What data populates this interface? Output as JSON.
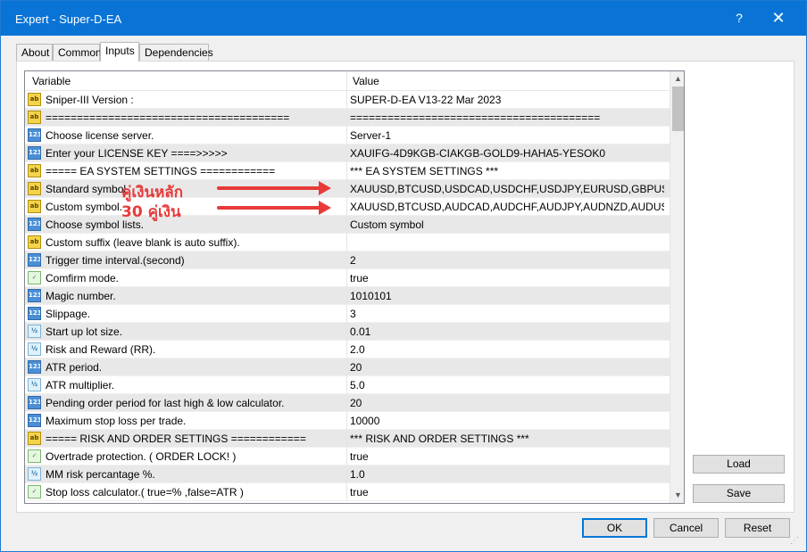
{
  "window": {
    "title": "Expert - Super-D-EA",
    "help_label": "?",
    "close_label": "✕"
  },
  "tabs": [
    {
      "label": "About",
      "active": false
    },
    {
      "label": "Common",
      "active": false
    },
    {
      "label": "Inputs",
      "active": true
    },
    {
      "label": "Dependencies",
      "active": false
    }
  ],
  "grid": {
    "header": {
      "variable": "Variable",
      "value": "Value"
    },
    "rows": [
      {
        "icon": "ab",
        "variable": "Sniper-III Version :",
        "value": "SUPER-D-EA V13-22 Mar 2023"
      },
      {
        "icon": "ab",
        "variable": "=======================================",
        "value": "========================================"
      },
      {
        "icon": "123",
        "variable": "Choose license server.",
        "value": "Server-1"
      },
      {
        "icon": "123",
        "variable": "Enter your LICENSE KEY ====>>>>>",
        "value": "XAUIFG-4D9KGB-CIAKGB-GOLD9-HAHA5-YESOK0"
      },
      {
        "icon": "ab",
        "variable": "===== EA SYSTEM SETTINGS ============",
        "value": "*** EA SYSTEM SETTINGS ***"
      },
      {
        "icon": "ab",
        "variable": "Standard symbol.",
        "value": "XAUUSD,BTCUSD,USDCAD,USDCHF,USDJPY,EURUSD,GBPUSD,N..."
      },
      {
        "icon": "ab",
        "variable": "Custom symbol.",
        "value": "XAUUSD,BTCUSD,AUDCAD,AUDCHF,AUDJPY,AUDNZD,AUDUSD,C..."
      },
      {
        "icon": "123",
        "variable": "Choose symbol lists.",
        "value": "Custom symbol"
      },
      {
        "icon": "ab",
        "variable": "Custom suffix (leave blank is auto suffix).",
        "value": ""
      },
      {
        "icon": "123",
        "variable": "Trigger time interval.(second)",
        "value": "2"
      },
      {
        "icon": "bool",
        "variable": "Comfirm mode.",
        "value": "true"
      },
      {
        "icon": "123",
        "variable": "Magic number.",
        "value": "1010101"
      },
      {
        "icon": "123",
        "variable": "Slippage.",
        "value": "3"
      },
      {
        "icon": "half",
        "variable": "Start up lot size.",
        "value": "0.01"
      },
      {
        "icon": "half",
        "variable": "Risk and Reward (RR).",
        "value": "2.0"
      },
      {
        "icon": "123",
        "variable": "ATR period.",
        "value": "20"
      },
      {
        "icon": "half",
        "variable": "ATR multiplier.",
        "value": "5.0"
      },
      {
        "icon": "123",
        "variable": "Pending order period for last high & low calculator.",
        "value": "20"
      },
      {
        "icon": "123",
        "variable": "Maximum stop loss per trade.",
        "value": "10000"
      },
      {
        "icon": "ab",
        "variable": "===== RISK AND ORDER SETTINGS ============",
        "value": "*** RISK AND ORDER SETTINGS ***"
      },
      {
        "icon": "bool",
        "variable": "Overtrade protection. ( ORDER LOCK! )",
        "value": "true"
      },
      {
        "icon": "half",
        "variable": "MM risk percantage %.",
        "value": "1.0"
      },
      {
        "icon": "bool",
        "variable": "Stop loss calculator.( true=% ,false=ATR )",
        "value": "true"
      }
    ]
  },
  "icons": {
    "ab": {
      "text": "ab",
      "name": "string-type-icon"
    },
    "123": {
      "text": "123",
      "name": "integer-type-icon"
    },
    "half": {
      "text": "½",
      "name": "double-type-icon"
    },
    "bool": {
      "text": "✓",
      "name": "bool-type-icon"
    }
  },
  "annotations": {
    "line1": "คู่เงินหลัก",
    "line2": "30 คู่เงิน",
    "color": "#e83a3a"
  },
  "side_buttons": {
    "load": "Load",
    "save": "Save"
  },
  "bottom_buttons": {
    "ok": "OK",
    "cancel": "Cancel",
    "reset": "Reset"
  },
  "scrollbar": {
    "up": "▲",
    "down": "▼"
  }
}
